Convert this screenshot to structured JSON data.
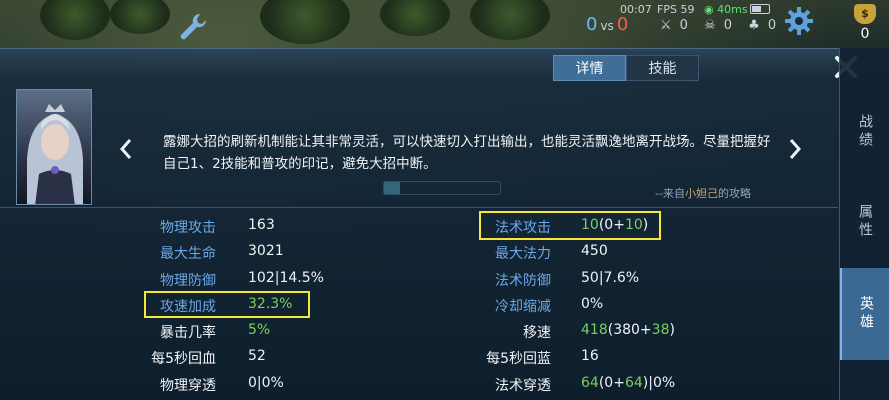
{
  "hud": {
    "time": "00:07",
    "score_blue": "0",
    "score_vs": "vs",
    "score_red": "0",
    "fps": "FPS 59",
    "ping": "40ms",
    "kills": "0",
    "deaths": "0",
    "assists": "0",
    "gold": "0",
    "gold_icon_glyph": "$",
    "icons": [
      "wrench-icon",
      "gear-icon",
      "sword-icon",
      "skull-icon",
      "battery-icon",
      "wifi-icon"
    ]
  },
  "tabs": [
    {
      "label": "详情",
      "active": true
    },
    {
      "label": "技能",
      "active": false
    }
  ],
  "hero": {
    "description": "露娜大招的刷新机制能让其非常灵活，可以快速切入打出输出，也能灵活飘逸地离开战场。尽量把握好自己1、2技能和普攻的印记，避免大招中断。",
    "source_prefix": "--来自",
    "source_author": "小妲己",
    "source_suffix": "的攻略"
  },
  "stats_left": [
    {
      "label": "物理攻击",
      "value": "163",
      "label_color": "blue"
    },
    {
      "label": "最大生命",
      "value": "3021",
      "label_color": "blue"
    },
    {
      "label": "物理防御",
      "value": "102|14.5%",
      "label_color": "blue"
    },
    {
      "label": "攻速加成",
      "value": "32.3%",
      "label_color": "blue",
      "value_color": "green",
      "highlighted": true
    },
    {
      "label": "暴击几率",
      "value": "5%",
      "label_color": "white",
      "value_color": "green"
    },
    {
      "label": "每5秒回血",
      "value": "52",
      "label_color": "white"
    },
    {
      "label": "物理穿透",
      "value": "0|0%",
      "label_color": "white"
    }
  ],
  "stats_right": [
    {
      "label": "法术攻击",
      "value_base": "10",
      "value_detail_a": "(0+",
      "value_detail_b": "10",
      "value_detail_c": ")",
      "label_color": "blue",
      "highlighted": true
    },
    {
      "label": "最大法力",
      "value": "450",
      "label_color": "blue"
    },
    {
      "label": "法术防御",
      "value": "50|7.6%",
      "label_color": "blue"
    },
    {
      "label": "冷却缩减",
      "value": "0%",
      "label_color": "blue"
    },
    {
      "label": "移速",
      "value_base": "418",
      "value_detail_a": "(380+",
      "value_detail_b": "38",
      "value_detail_c": ")",
      "label_color": "white"
    },
    {
      "label": "每5秒回蓝",
      "value": "16",
      "label_color": "white"
    },
    {
      "label": "法术穿透",
      "value_base": "64",
      "value_detail_a": "(0+",
      "value_detail_b": "64",
      "value_detail_c": ")|0%",
      "label_color": "white"
    }
  ],
  "side_tabs": [
    {
      "label": "战绩",
      "active": false
    },
    {
      "label": "属性",
      "active": false
    },
    {
      "label": "英雄",
      "active": true
    }
  ],
  "colors": {
    "accent_blue": "#6aa7e6",
    "green": "#7bd05c",
    "highlight_yellow": "#f4e73a",
    "active_tab": "#3f6f98"
  }
}
